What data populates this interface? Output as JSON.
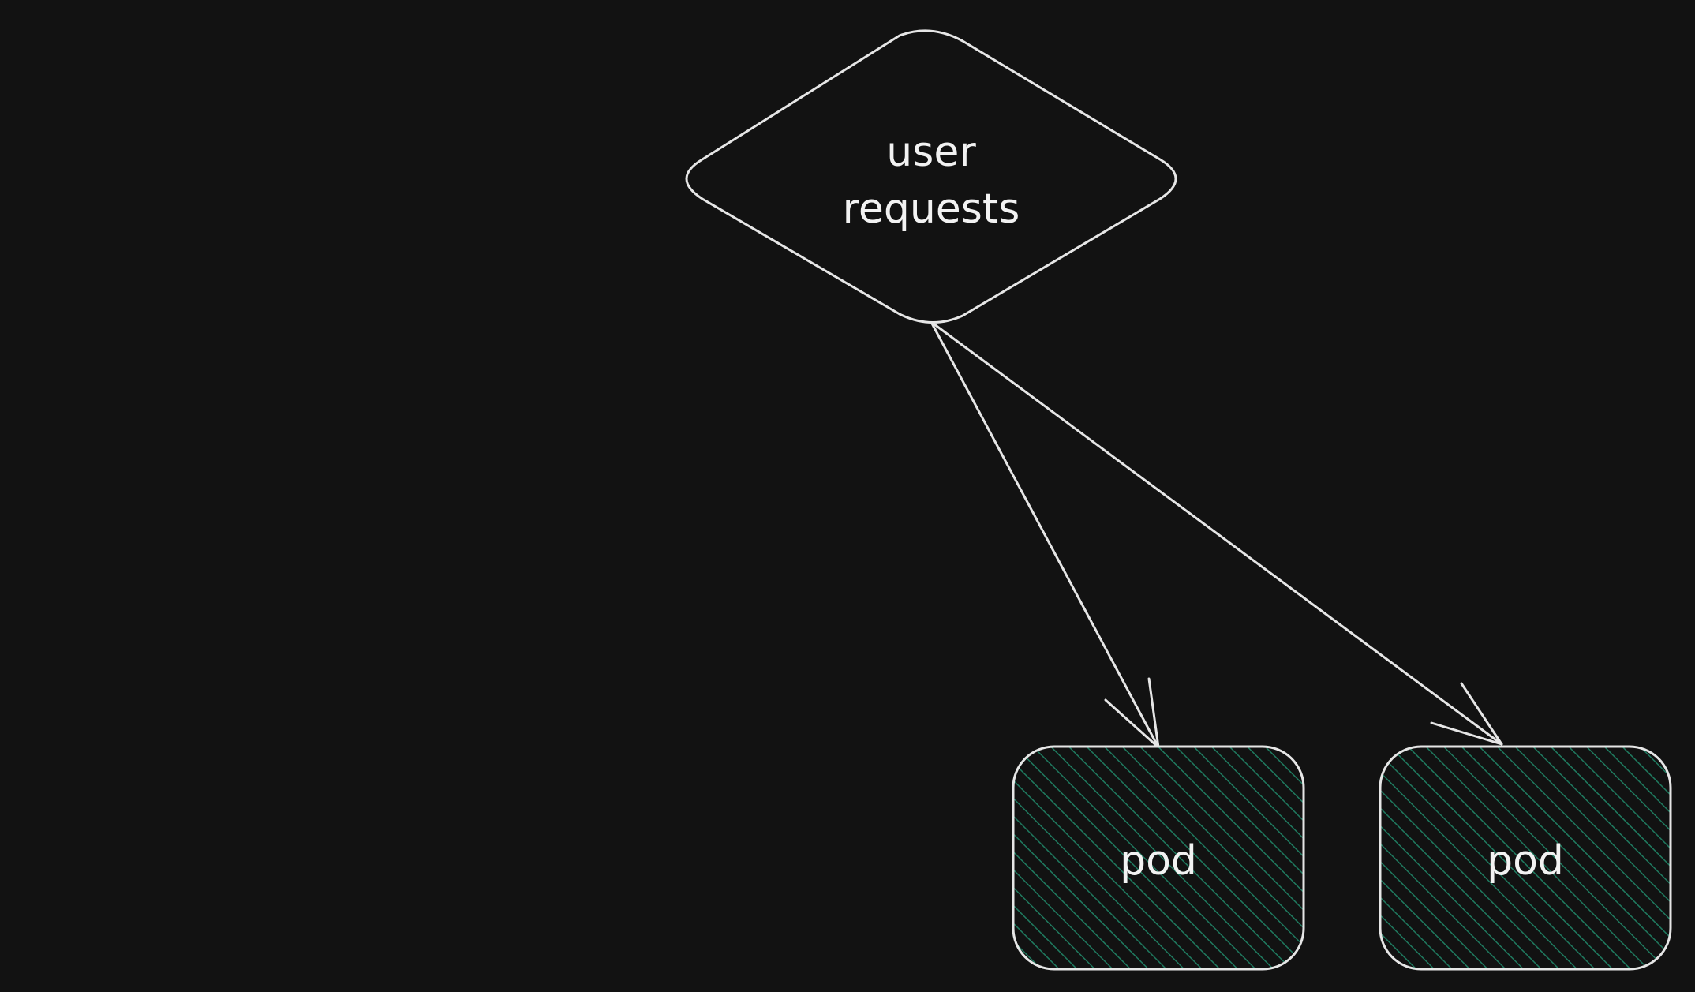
{
  "diagram": {
    "nodes": [
      {
        "id": "user-requests",
        "shape": "diamond",
        "label_lines": [
          "user",
          "requests"
        ]
      },
      {
        "id": "pod-1",
        "shape": "rounded-rect",
        "label": "pod",
        "fill": "#1b5e4a"
      },
      {
        "id": "pod-2",
        "shape": "rounded-rect",
        "label": "pod",
        "fill": "#1b5e4a"
      }
    ],
    "edges": [
      {
        "from": "user-requests",
        "to": "pod-1",
        "arrow": "end"
      },
      {
        "from": "user-requests",
        "to": "pod-2",
        "arrow": "end"
      }
    ],
    "colors": {
      "background": "#121212",
      "stroke": "#e6e6e6",
      "hatch": "#1f7a5f"
    }
  }
}
